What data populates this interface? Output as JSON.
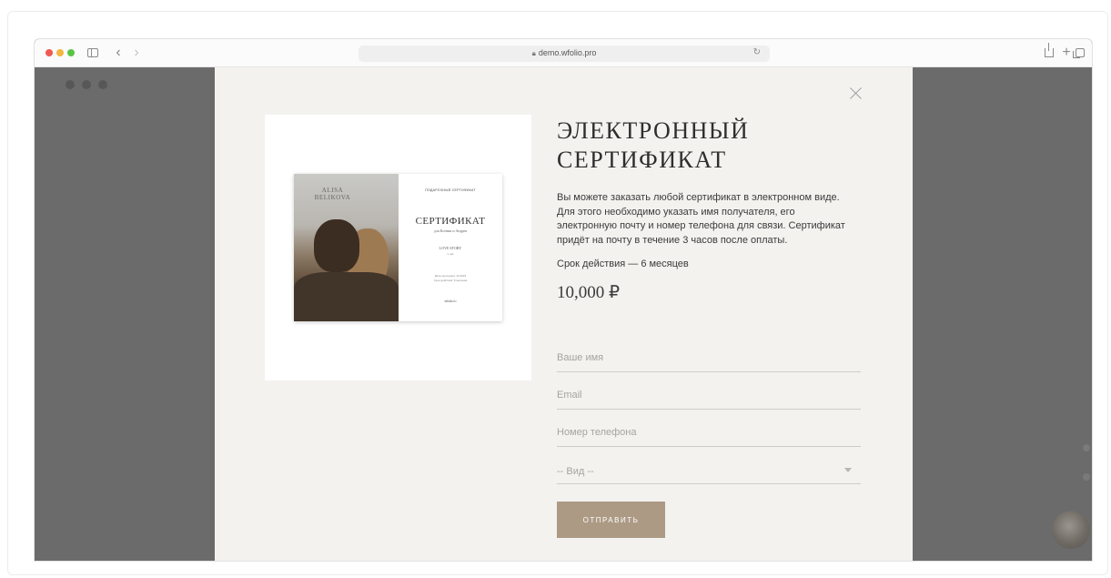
{
  "browser": {
    "url": "demo.wfolio.pro",
    "icons": {
      "lock": "lock-icon",
      "reload": "reload-icon",
      "back": "chevron-left-icon",
      "forward": "chevron-right-icon",
      "sidebar": "sidebar-toggle-icon",
      "share": "share-icon",
      "new_tab": "plus-icon",
      "tabs": "tab-overview-icon"
    },
    "colors": {
      "traffic_red": "#ee5a52",
      "traffic_yellow": "#f4b63f",
      "traffic_green": "#5bc447"
    }
  },
  "certificate_image": {
    "brand": "ALISA\nBELIKOVA",
    "top_line": "ПОДАРОЧНЫЙ СЕРТИФИКАТ",
    "title": "СЕРТИФИКАТ",
    "subtitle": "для Ксении и Андрея",
    "story": "LOVE STORY",
    "story_sub": "1 час",
    "note": "Дата окончания: 10.2024\nСрок действия: 6 месяцев",
    "site": "wfolio.ru"
  },
  "modal": {
    "title": "ЭЛЕКТРОННЫЙ СЕРТИФИКАТ",
    "description": "Вы можете заказать любой сертификат в электронном виде. Для этого необходимо указать имя получателя, его электронную почту и номер телефона для связи. Сертификат придёт на почту в течение 3 часов после оплаты.",
    "validity": "Срок действия  — 6 месяцев",
    "price": "10,000 ₽",
    "form": {
      "name_placeholder": "Ваше имя",
      "email_placeholder": "Email",
      "phone_placeholder": "Номер телефона",
      "type_select": "-- Вид --",
      "submit_label": "ОТПРАВИТЬ"
    },
    "colors": {
      "background": "#f3f2ef",
      "accent_button": "#ad9a85",
      "overlay": "#6b6b6b"
    }
  }
}
